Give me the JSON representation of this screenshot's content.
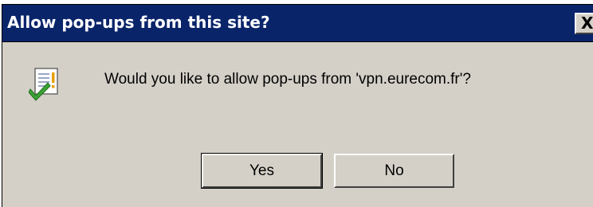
{
  "dialog": {
    "title": "Allow pop-ups from this site?",
    "close_glyph": "X",
    "icon": "popup-checkmark-icon",
    "message": "Would you like to allow pop-ups from 'vpn.eurecom.fr'?",
    "buttons": {
      "yes_label": "Yes",
      "no_label": "No"
    }
  },
  "colors": {
    "titlebar": "#0a246a",
    "face": "#d4d0c8",
    "check": "#3aa335",
    "warning": "#e8a000"
  }
}
